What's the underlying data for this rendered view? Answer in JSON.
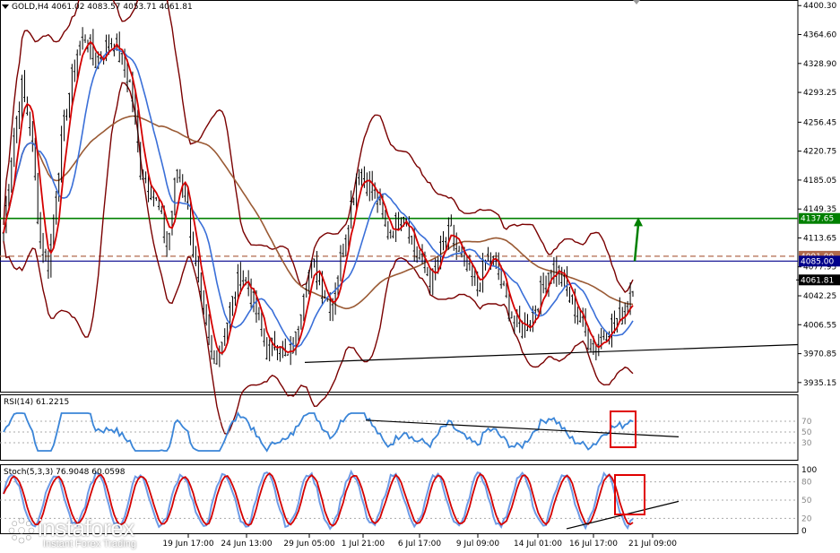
{
  "chart_data": [
    {
      "type": "line",
      "symbol_header": "GOLD,H4  4061.02 4083.57 4053.71 4061.81",
      "ylim": [
        3925,
        4405
      ],
      "y_ticks": [
        4400.3,
        4364.6,
        4328.9,
        4293.2,
        4256.4,
        4220.7,
        4185.0,
        4149.3,
        4113.6,
        4077.95,
        4042.2,
        4006.55,
        3970.8,
        3935.15
      ],
      "y_tick_labels": [
        "4400.30",
        "4364.60",
        "4328.90",
        "4293.25",
        "4256.45",
        "4220.75",
        "4185.05",
        "4149.35",
        "4113.65",
        "4077.95",
        "4042.25",
        "4006.55",
        "3970.85",
        "3935.15"
      ],
      "x_tick_labels": [
        "19 Jun 17:00",
        "24 Jun 13:00",
        "29 Jun 05:00",
        "1 Jul 21:00",
        "6 Jul 17:00",
        "9 Jul 09:00",
        "14 Jul 01:00",
        "16 Jul 17:00",
        "21 Jul 09:00"
      ],
      "levels": [
        {
          "value": 4137.65,
          "label": "4137.65",
          "color": "#008000"
        },
        {
          "value": 4091.0,
          "label": "4091.00",
          "color": "#b06a4c"
        },
        {
          "value": 4085.0,
          "label": "4085.00",
          "color": "#00008b"
        },
        {
          "value": 4061.81,
          "label": "4061.81",
          "color": "#000000"
        }
      ],
      "price_path": [
        4120,
        4230,
        4300,
        4250,
        4110,
        4080,
        4200,
        4280,
        4340,
        4365,
        4330,
        4345,
        4360,
        4330,
        4300,
        4200,
        4180,
        4150,
        4100,
        4200,
        4170,
        4080,
        4010,
        3960,
        3990,
        4030,
        4070,
        4050,
        4010,
        3970,
        3990,
        3960,
        3985,
        4060,
        4080,
        4050,
        4030,
        4090,
        4150,
        4200,
        4180,
        4160,
        4120,
        4130,
        4150,
        4100,
        4080,
        4060,
        4100,
        4120,
        4090,
        4070,
        4050,
        4090,
        4080,
        4040,
        4010,
        4000,
        4020,
        4050,
        4080,
        4070,
        4040,
        4020,
        3990,
        3980,
        4000,
        4010,
        4020,
        4060
      ],
      "trendlines": [
        {
          "name": "support",
          "from": [
            340,
            3960
          ],
          "to": [
            890,
            3982
          ]
        }
      ],
      "arrow": {
        "from": [
          708,
          4085
        ],
        "to": [
          712,
          4137
        ]
      }
    },
    {
      "type": "line",
      "title": "RSI(14) 61.2215",
      "ylim": [
        0,
        100
      ],
      "y_tick_labels": [
        "70",
        "50",
        "30"
      ],
      "y_ticks": [
        70,
        50,
        30
      ]
    },
    {
      "type": "line",
      "title": "Stoch(5,3,3) 76.9048 60.0598",
      "ylim": [
        0,
        100
      ],
      "y_tick_labels": [
        "100",
        "80",
        "50",
        "20",
        "0"
      ],
      "y_ticks": [
        100,
        80,
        50,
        20,
        0
      ]
    }
  ],
  "colors": {
    "ma_red": "#d40000",
    "ma_blue": "#3a6fd8",
    "ma_brown": "#9a5a34",
    "band": "#7a0000",
    "rsi": "#3a85d8",
    "stoch_main": "#6e9be6",
    "stoch_signal": "#d40000",
    "highlight": "#e00000"
  },
  "brand": {
    "name": "instaforex",
    "tagline": "Instant Forex Trading"
  }
}
